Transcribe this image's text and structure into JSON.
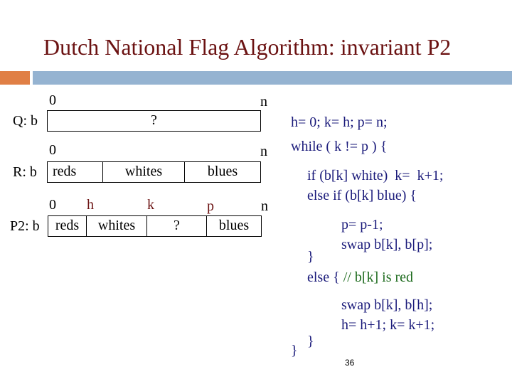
{
  "slide": {
    "title": "Dutch National Flag Algorithm: invariant P2",
    "page_number": "36",
    "colors": {
      "title": "#6b1212",
      "accent_orange": "#e07f45",
      "accent_blue": "#95b3d1",
      "code": "#1a1a7a",
      "comment": "#1e6b1e"
    }
  },
  "diagrams": {
    "q": {
      "label": "Q: b",
      "start_index": "0",
      "end_index": "n",
      "cells": [
        "?"
      ]
    },
    "r": {
      "label": "R: b",
      "start_index": "0",
      "end_index": "n",
      "cells": [
        "reds",
        "whites",
        "blues"
      ]
    },
    "p2": {
      "label": "P2: b",
      "start_index": "0",
      "h_marker": "h",
      "k_marker": "k",
      "p_marker": "p",
      "end_index": "n",
      "cells": [
        "reds",
        "whites",
        "?",
        "blues"
      ]
    }
  },
  "code": {
    "line1": "h= 0; k= h; p= n;",
    "line2": "while ( k != p ) {",
    "line3": "if (b[k] white)  k=  k+1;",
    "line4": "else if (b[k] blue) {",
    "line5": "p= p-1;",
    "line6": "swap b[k], b[p];",
    "line7": "}",
    "line8_code": "else { ",
    "line8_comment": "// b[k] is red",
    "line9": "swap b[k], b[h];",
    "line10": "h= h+1; k= k+1;",
    "line11": "}",
    "line12": "}"
  }
}
